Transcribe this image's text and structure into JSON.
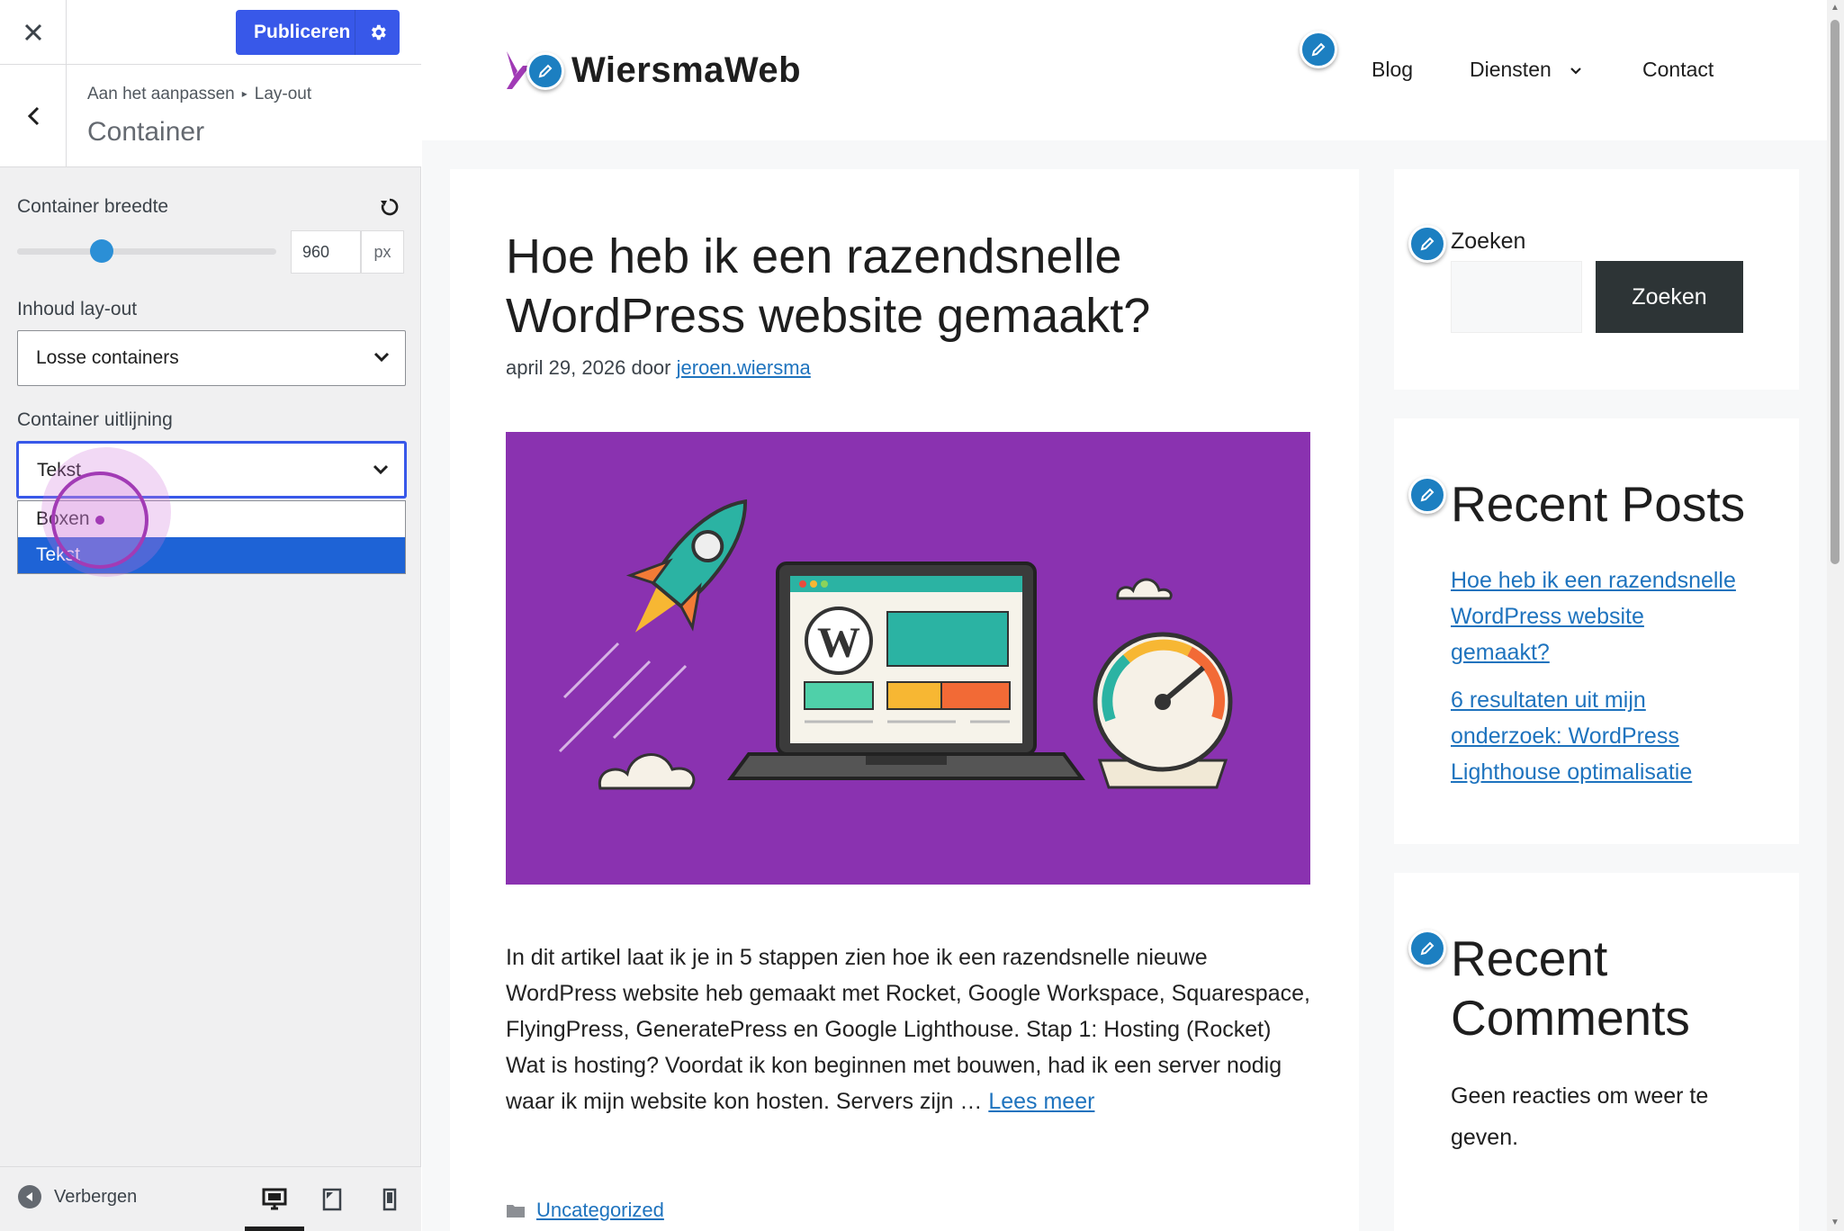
{
  "customizer": {
    "topbar": {
      "publish_label": "Publiceren",
      "close_icon": "close-icon",
      "settings_icon": "gear-icon"
    },
    "section": {
      "breadcrumb_root": "Aan het aanpassen",
      "breadcrumb_parent": "Lay-out",
      "title": "Container"
    },
    "controls": {
      "container_width": {
        "label": "Container breedte",
        "value": "960",
        "unit": "px",
        "slider_fraction": 0.3
      },
      "content_layout": {
        "label": "Inhoud lay-out",
        "selected": "Losse containers"
      },
      "container_alignment": {
        "label": "Container uitlijning",
        "selected": "Tekst",
        "options": [
          "Boxen",
          "Tekst"
        ],
        "highlighted_option": "Tekst"
      }
    },
    "footer": {
      "hide_label": "Verbergen",
      "active_device": "desktop"
    }
  },
  "site": {
    "title": "WiersmaWeb",
    "nav": [
      "Blog",
      "Diensten",
      "Contact"
    ],
    "post": {
      "title": "Hoe heb ik een razendsnelle WordPress website gemaakt?",
      "date": "april 29, 2026",
      "by": "door",
      "author": "jeroen.wiersma",
      "excerpt": "In dit artikel laat ik je in 5 stappen zien hoe ik een razendsnelle nieuwe WordPress website heb gemaakt met Rocket, Google Workspace, Squarespace, FlyingPress, GeneratePress en Google Lighthouse. Stap 1: Hosting (Rocket) Wat is hosting? Voordat ik kon beginnen met bouwen, had ik een server nodig waar ik mijn website kon hosten. Servers zijn …",
      "read_more": "Lees meer",
      "category": "Uncategorized"
    },
    "sidebar": {
      "search_label": "Zoeken",
      "search_button": "Zoeken",
      "recent_posts_title": "Recent Posts",
      "recent_posts": [
        "Hoe heb ik een razendsnelle WordPress website gemaakt?",
        "6 resultaten uit mijn onderzoek: WordPress Lighthouse optimalisatie"
      ],
      "recent_comments_title": "Recent Comments",
      "no_comments": "Geen reacties om weer te geven."
    }
  },
  "colors": {
    "publish": "#3858e9",
    "link": "#1e73be",
    "edit_badge": "#1c7fc1",
    "image_bg": "#8a32b0",
    "select_highlight": "#1e63d6"
  }
}
